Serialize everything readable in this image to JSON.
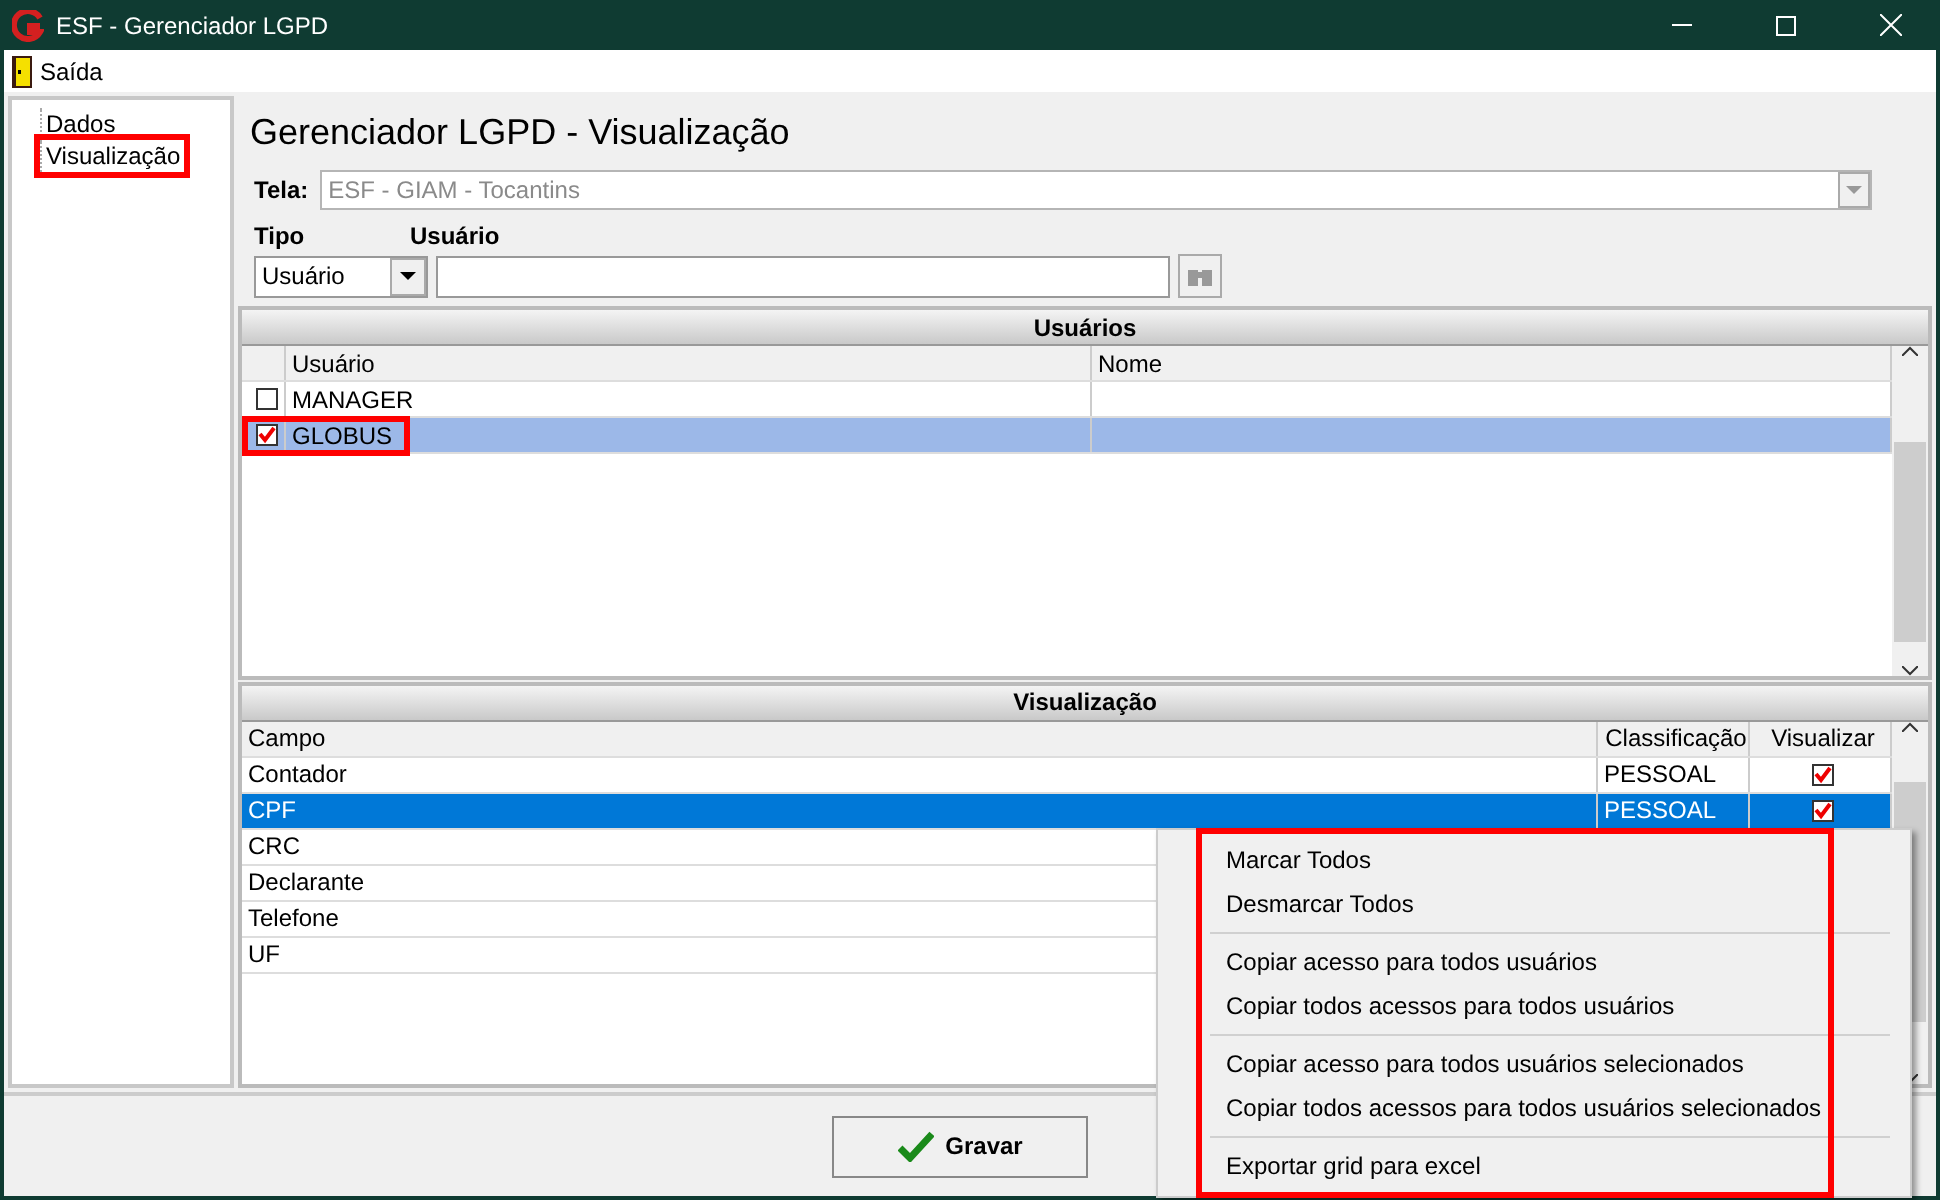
{
  "window": {
    "title": "ESF - Gerenciador LGPD"
  },
  "menu": [
    "Saída"
  ],
  "tree": [
    {
      "label": "Dados",
      "annotated": false
    },
    {
      "label": "Visualização",
      "annotated": true
    }
  ],
  "heading": "Gerenciador LGPD - Visualização",
  "tela": {
    "label": "Tela:",
    "value": "ESF - GIAM - Tocantins"
  },
  "tipo": {
    "label": "Tipo",
    "value": "Usuário"
  },
  "usuario": {
    "label": "Usuário"
  },
  "users_grid": {
    "title": "Usuários",
    "columns": [
      "Usuário",
      "Nome"
    ],
    "rows": [
      {
        "usuario": "MANAGER",
        "checked": false,
        "selected": false,
        "annotated": false
      },
      {
        "usuario": "GLOBUS",
        "checked": true,
        "selected": true,
        "annotated": true
      }
    ]
  },
  "fields_grid": {
    "title": "Visualização",
    "columns": [
      "Campo",
      "Classificação",
      "Visualizar"
    ],
    "rows": [
      {
        "campo": "Contador",
        "classificacao": "PESSOAL",
        "visualizar": true,
        "selected": false
      },
      {
        "campo": "CPF",
        "classificacao": "PESSOAL",
        "visualizar": true,
        "selected": true
      },
      {
        "campo": "CRC",
        "selected": false
      },
      {
        "campo": "Declarante",
        "selected": false
      },
      {
        "campo": "Telefone",
        "selected": false
      },
      {
        "campo": "UF",
        "selected": false
      }
    ]
  },
  "context_menu": {
    "annotated": true,
    "groups": [
      [
        "Marcar Todos",
        "Desmarcar Todos"
      ],
      [
        "Copiar acesso para todos usuários",
        "Copiar todos acessos para todos usuários"
      ],
      [
        "Copiar acesso para todos usuários selecionados",
        "Copiar todos acessos para todos usuários selecionados"
      ],
      [
        "Exportar grid para excel"
      ]
    ]
  },
  "save_button": "Gravar"
}
